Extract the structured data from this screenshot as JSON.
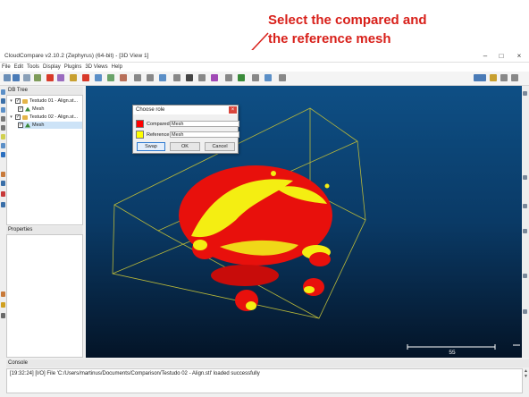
{
  "annotation": {
    "line1": "Select the compared and",
    "line2": "the reference mesh",
    "color": "#d8201a"
  },
  "window": {
    "title": "CloudCompare v2.10.2 (Zephyrus) (64-bit) - [3D View 1]",
    "controls": [
      "–",
      "□",
      "×"
    ]
  },
  "menu": [
    "File",
    "Edit",
    "Tools",
    "Display",
    "Plugins",
    "3D Views",
    "Help"
  ],
  "db_tree": {
    "title": "DB Tree",
    "items": [
      {
        "label": "Testudo 01 - Align.st...",
        "kind": "folder",
        "checked": true
      },
      {
        "label": "Mesh",
        "kind": "mesh",
        "checked": true
      },
      {
        "label": "Testudo 02 - Align.st...",
        "kind": "folder",
        "checked": true
      },
      {
        "label": "Mesh",
        "kind": "mesh",
        "checked": true
      }
    ]
  },
  "properties": {
    "title": "Properties"
  },
  "view3d": {
    "scale_label": "55",
    "background_top": "#0e4f85",
    "background_bottom": "#041427",
    "compared_color": "#e8100c",
    "reference_color": "#f4ee12",
    "bbox_color": "#b8b83a"
  },
  "dialog": {
    "title": "Choose role",
    "close": "×",
    "compared": {
      "label": "Compared",
      "value": "Mesh",
      "color": "#ff0000"
    },
    "reference": {
      "label": "Reference",
      "value": "Mesh",
      "color": "#ffff00"
    },
    "buttons": {
      "swap": "Swap",
      "ok": "OK",
      "cancel": "Cancel"
    }
  },
  "console": {
    "title": "Console",
    "lines": [
      "[19:32:24] [I/O] File 'C:/Users/martinus/Documents/Comparison/Testudo 02 - Align.stl' loaded successfully"
    ]
  }
}
